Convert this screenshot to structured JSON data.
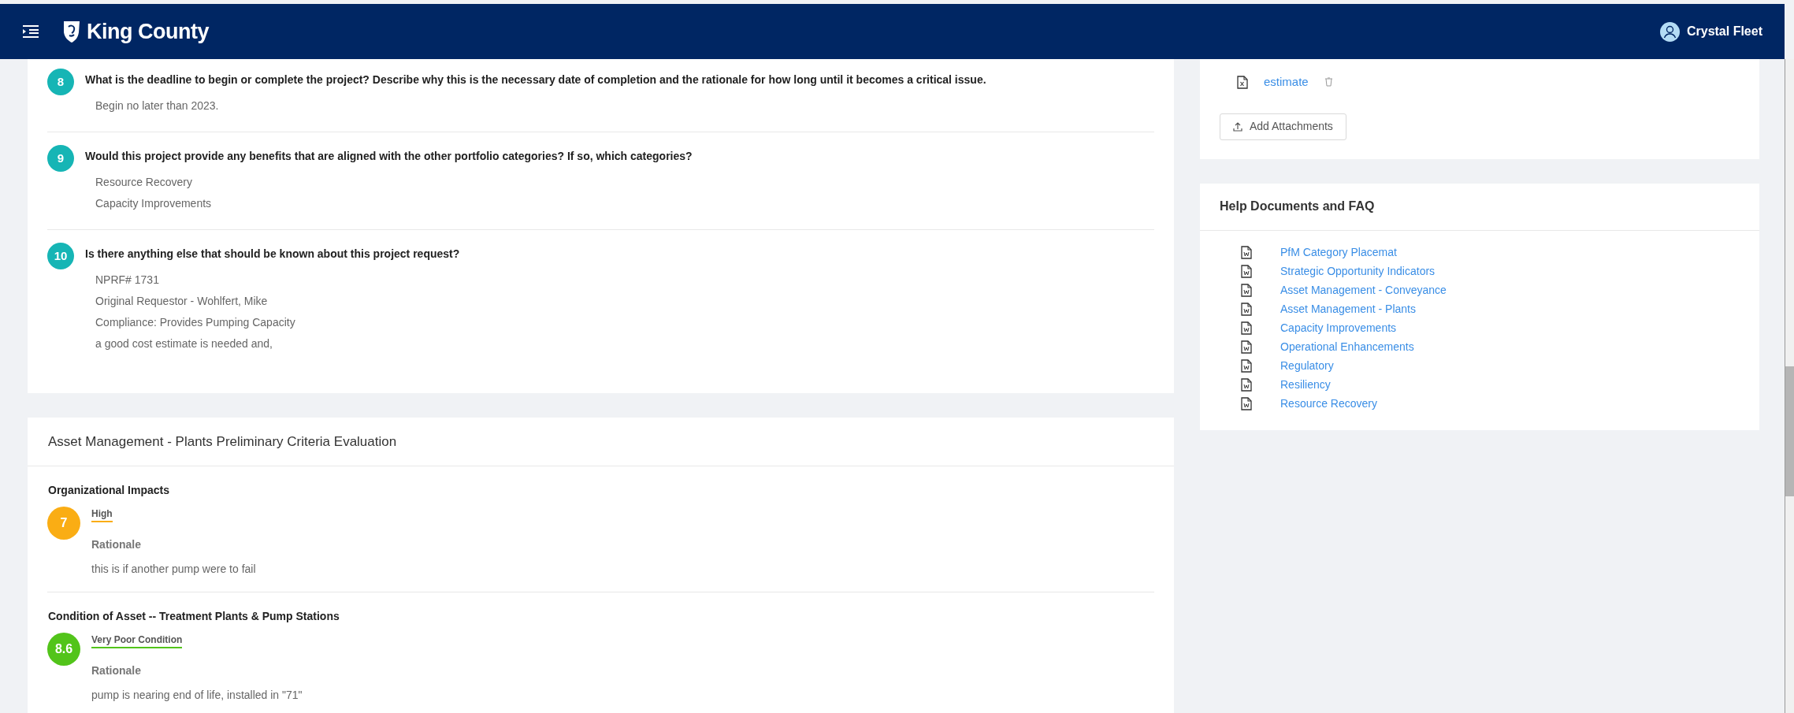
{
  "header": {
    "brand": "King County",
    "user": "Crystal Fleet"
  },
  "questions": [
    {
      "number": "8",
      "text": "What is the deadline to begin or complete the project? Describe why this is the necessary date of completion and the rationale for how long until it becomes a critical issue.",
      "answer": [
        "Begin no later than 2023."
      ]
    },
    {
      "number": "9",
      "text": "Would this project provide any benefits that are aligned with the other portfolio categories? If so, which categories?",
      "answer": [
        "Resource Recovery",
        "Capacity Improvements"
      ]
    },
    {
      "number": "10",
      "text": "Is there anything else that should be known about this project request?",
      "answer": [
        "NPRF# 1731",
        "Original Requestor - Wohlfert, Mike",
        "Compliance: Provides Pumping Capacity",
        "a good cost estimate is needed and,"
      ]
    }
  ],
  "evaluation": {
    "title": "Asset Management - Plants Preliminary Criteria Evaluation",
    "criteria": [
      {
        "name": "Organizational Impacts",
        "score": "7",
        "color": "#faad14",
        "rating": "High",
        "rationale_label": "Rationale",
        "rationale": "this is if another pump were to fail"
      },
      {
        "name": "Condition of Asset -- Treatment Plants & Pump Stations",
        "score": "8.6",
        "color": "#52c41a",
        "rating": "Very Poor Condition",
        "rationale_label": "Rationale",
        "rationale": "pump is nearing end of life, installed in \"71\""
      }
    ]
  },
  "attachments": {
    "files": [
      {
        "name": "estimate"
      }
    ],
    "add_button": "Add Attachments"
  },
  "help": {
    "title": "Help Documents and FAQ",
    "documents": [
      "PfM Category Placemat",
      "Strategic Opportunity Indicators",
      "Asset Management - Conveyance",
      "Asset Management - Plants",
      "Capacity Improvements",
      "Operational Enhancements",
      "Regulatory",
      "Resiliency",
      "Resource Recovery"
    ]
  }
}
